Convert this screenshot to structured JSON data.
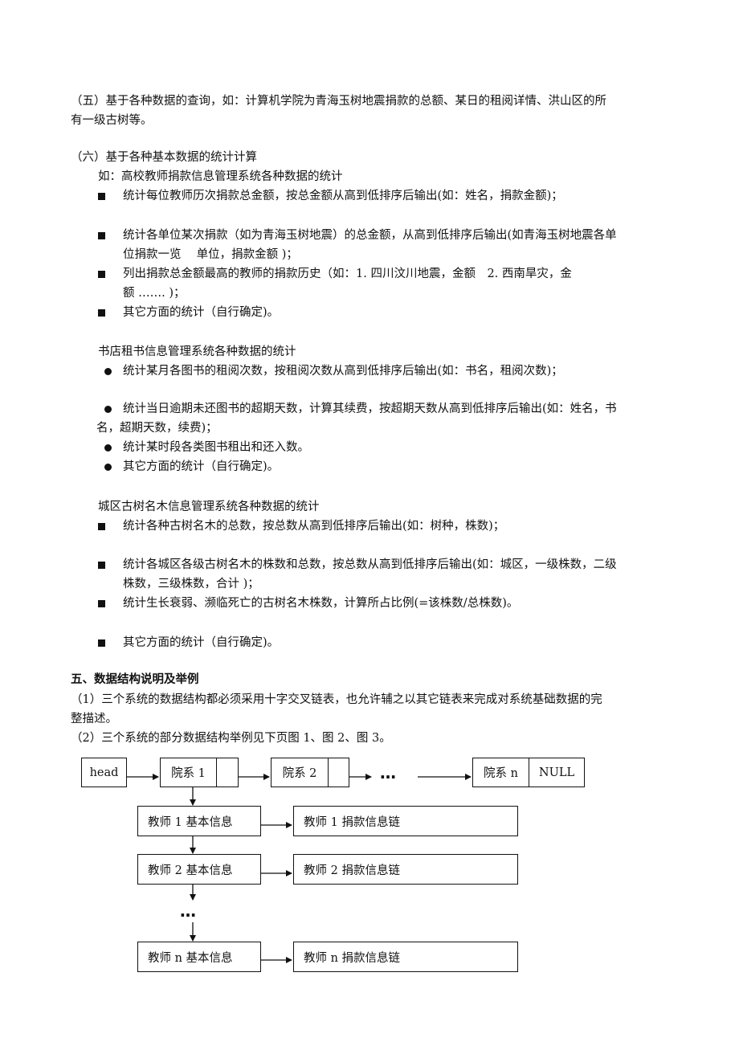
{
  "section5": {
    "item_wu": {
      "line1": "（五）基于各种数据的查询，如：计算机学院为青海玉树地震捐款的总额、某日的租阅详情、洪山区的所",
      "line2": "有一级古树等。"
    },
    "item_liu": {
      "title": "（六）基于各种基本数据的统计计算",
      "intro": "如：高校教师捐款信息管理系统各种数据的统计"
    },
    "donation_stats": [
      {
        "lines": [
          "统计每位教师历次捐款总金额，按总金额从高到低排序后输出(如：姓名，捐款金额)；"
        ]
      },
      {
        "lines": [
          "统计各单位某次捐款（如为青海玉树地震）的总金额，从高到低排序后输出(如青海玉树地震各单",
          "位捐款一览　 单位，捐款金额 )；"
        ]
      },
      {
        "lines": [
          "列出捐款总金额最高的教师的捐款历史（如：1. 四川汶川地震，金额　2. 西南旱灾，金",
          "额 ……. )；"
        ]
      },
      {
        "lines": [
          "其它方面的统计（自行确定)。"
        ]
      }
    ],
    "bookstore": {
      "title": "书店租书信息管理系统各种数据的统计",
      "items": [
        {
          "lines": [
            "统计某月各图书的租阅次数，按租阅次数从高到低排序后输出(如：书名，租阅次数)；"
          ]
        },
        {
          "lines": [
            "统计当日逾期未还图书的超期天数，计算其续费，按超期天数从高到低排序后输出(如：姓名，书",
            "名，超期天数，续费)；"
          ]
        },
        {
          "lines": [
            "统计某时段各类图书租出和还入数。"
          ]
        },
        {
          "lines": [
            "其它方面的统计（自行确定)。"
          ]
        }
      ]
    },
    "trees": {
      "title": "城区古树名木信息管理系统各种数据的统计",
      "items": [
        {
          "lines": [
            "统计各种古树名木的总数，按总数从高到低排序后输出(如：树种，株数)；"
          ]
        },
        {
          "lines": [
            "统计各城区各级古树名木的株数和总数，按总数从高到低排序后输出(如：城区，一级株数，二级",
            "株数，三级株数，合计 )；"
          ]
        },
        {
          "lines": [
            "统计生长衰弱、濒临死亡的古树名木株数，计算所占比例(=该株数/总株数)。"
          ]
        },
        {
          "lines": [
            "其它方面的统计（自行确定)。"
          ]
        }
      ]
    }
  },
  "section_data_structure": {
    "heading": "五、数据结构说明及举例",
    "p1_line1": "（1）三个系统的数据结构都必须采用十字交叉链表，也允许辅之以其它链表来完成对系统基础数据的完",
    "p1_line2": "整描述。",
    "p2": "（2）三个系统的部分数据结构举例见下页图 1、图 2、图 3。"
  },
  "diagram": {
    "head": "head",
    "departments": [
      "院系 1",
      "院系 2",
      "院系 n"
    ],
    "null_label": "NULL",
    "ellipsis": "…",
    "teachers": [
      {
        "basic": "教师 1 基本信息",
        "donation": "教师 1 捐款信息链"
      },
      {
        "basic": "教师 2 基本信息",
        "donation": "教师 2 捐款信息链"
      },
      {
        "basic": "教师 n 基本信息",
        "donation": "教师 n 捐款信息链"
      }
    ]
  }
}
